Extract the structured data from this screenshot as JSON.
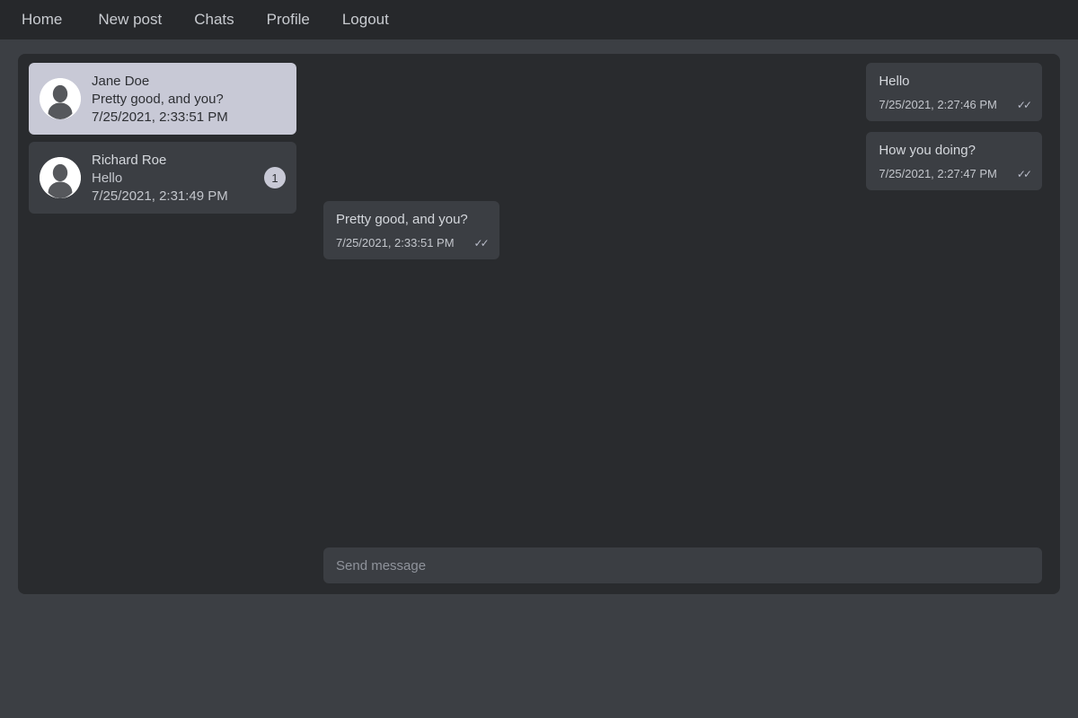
{
  "navbar": {
    "items": [
      {
        "label": "Home",
        "name": "nav-link-home"
      },
      {
        "label": "New post",
        "name": "nav-link-new-post"
      },
      {
        "label": "Chats",
        "name": "nav-link-chats"
      },
      {
        "label": "Profile",
        "name": "nav-link-profile"
      },
      {
        "label": "Logout",
        "name": "nav-link-logout"
      }
    ]
  },
  "sidebar": {
    "chats": [
      {
        "name": "Jane Doe",
        "last_message": "Pretty good, and you?",
        "timestamp": "7/25/2021, 2:33:51 PM",
        "unread": "",
        "active": true
      },
      {
        "name": "Richard Roe",
        "last_message": "Hello",
        "timestamp": "7/25/2021, 2:31:49 PM",
        "unread": "1",
        "active": false
      }
    ]
  },
  "conversation": {
    "messages": [
      {
        "text": "Hello",
        "timestamp": "7/25/2021, 2:27:46 PM",
        "ticks": "✓✓",
        "direction": "out"
      },
      {
        "text": "How you doing?",
        "timestamp": "7/25/2021, 2:27:47 PM",
        "ticks": "✓✓",
        "direction": "out"
      },
      {
        "text": "Pretty good, and you?",
        "timestamp": "7/25/2021, 2:33:51 PM",
        "ticks": "✓✓",
        "direction": "in"
      }
    ]
  },
  "composer": {
    "placeholder": "Send message",
    "value": ""
  },
  "colors": {
    "page_background": "#3c3f44",
    "navbar_background": "#26282b",
    "card_background": "#292b2e",
    "bubble_background": "#3b3e43",
    "accent_selected": "#c8c9d6",
    "text_primary": "#d5d8dd",
    "text_muted": "#c3c6cc"
  }
}
